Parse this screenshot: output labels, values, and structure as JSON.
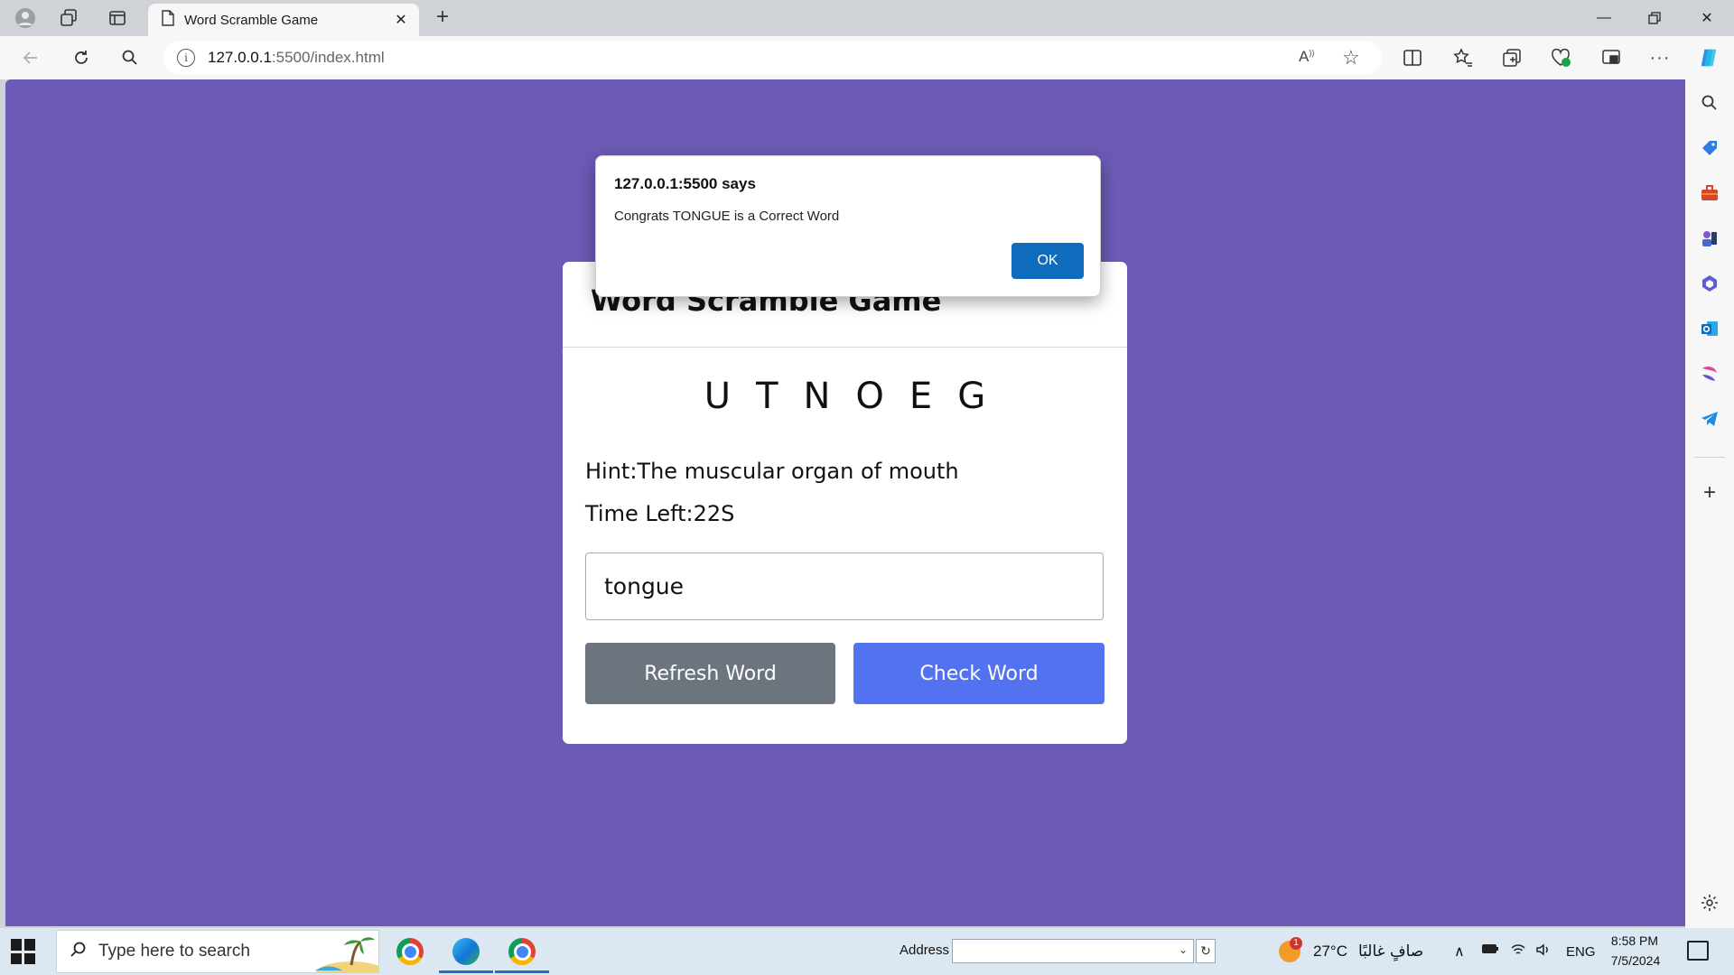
{
  "browser": {
    "tab_title": "Word Scramble Game",
    "url_host": "127.0.0.1",
    "url_rest": ":5500/index.html"
  },
  "alert": {
    "title": "127.0.0.1:5500 says",
    "message": "Congrats TONGUE is a Correct Word",
    "ok_label": "OK"
  },
  "game": {
    "title": "Word Scramble Game",
    "scrambled_word": "UTNOEG",
    "hint": "Hint:The muscular organ of mouth",
    "time_left": "Time Left:22S",
    "input_value": "tongue",
    "refresh_label": "Refresh Word",
    "check_label": "Check Word"
  },
  "taskbar": {
    "search_placeholder": "Type here to search",
    "address_label": "Address",
    "weather_badge": "1",
    "temperature": "27°C",
    "weather_condition": "صافٍ غالبًا",
    "language": "ENG",
    "time": "8:58 PM",
    "date": "7/5/2024"
  },
  "colors": {
    "page_bg": "#6c5ab6",
    "refresh_button": "#6c757d",
    "check_button": "#5372f0",
    "dialog_ok": "#0f6cbd"
  },
  "icons": {
    "tabstrip": [
      "profile-icon",
      "workspaces-icon",
      "tab-actions-icon",
      "page-icon",
      "close-icon",
      "new-tab-icon"
    ],
    "toolbar": [
      "back-icon",
      "refresh-icon",
      "search-icon",
      "info-icon",
      "read-aloud-icon",
      "favorite-star-icon",
      "split-screen-icon",
      "favorites-icon",
      "collections-icon",
      "browser-essentials-icon",
      "screenshot-icon",
      "more-icon",
      "copilot-icon"
    ],
    "sidebar": [
      "sidebar-search-icon",
      "shopping-icon",
      "tools-icon",
      "games-icon",
      "microsoft365-icon",
      "outlook-icon",
      "designer-icon",
      "telegram-icon",
      "add-icon",
      "settings-icon"
    ]
  }
}
